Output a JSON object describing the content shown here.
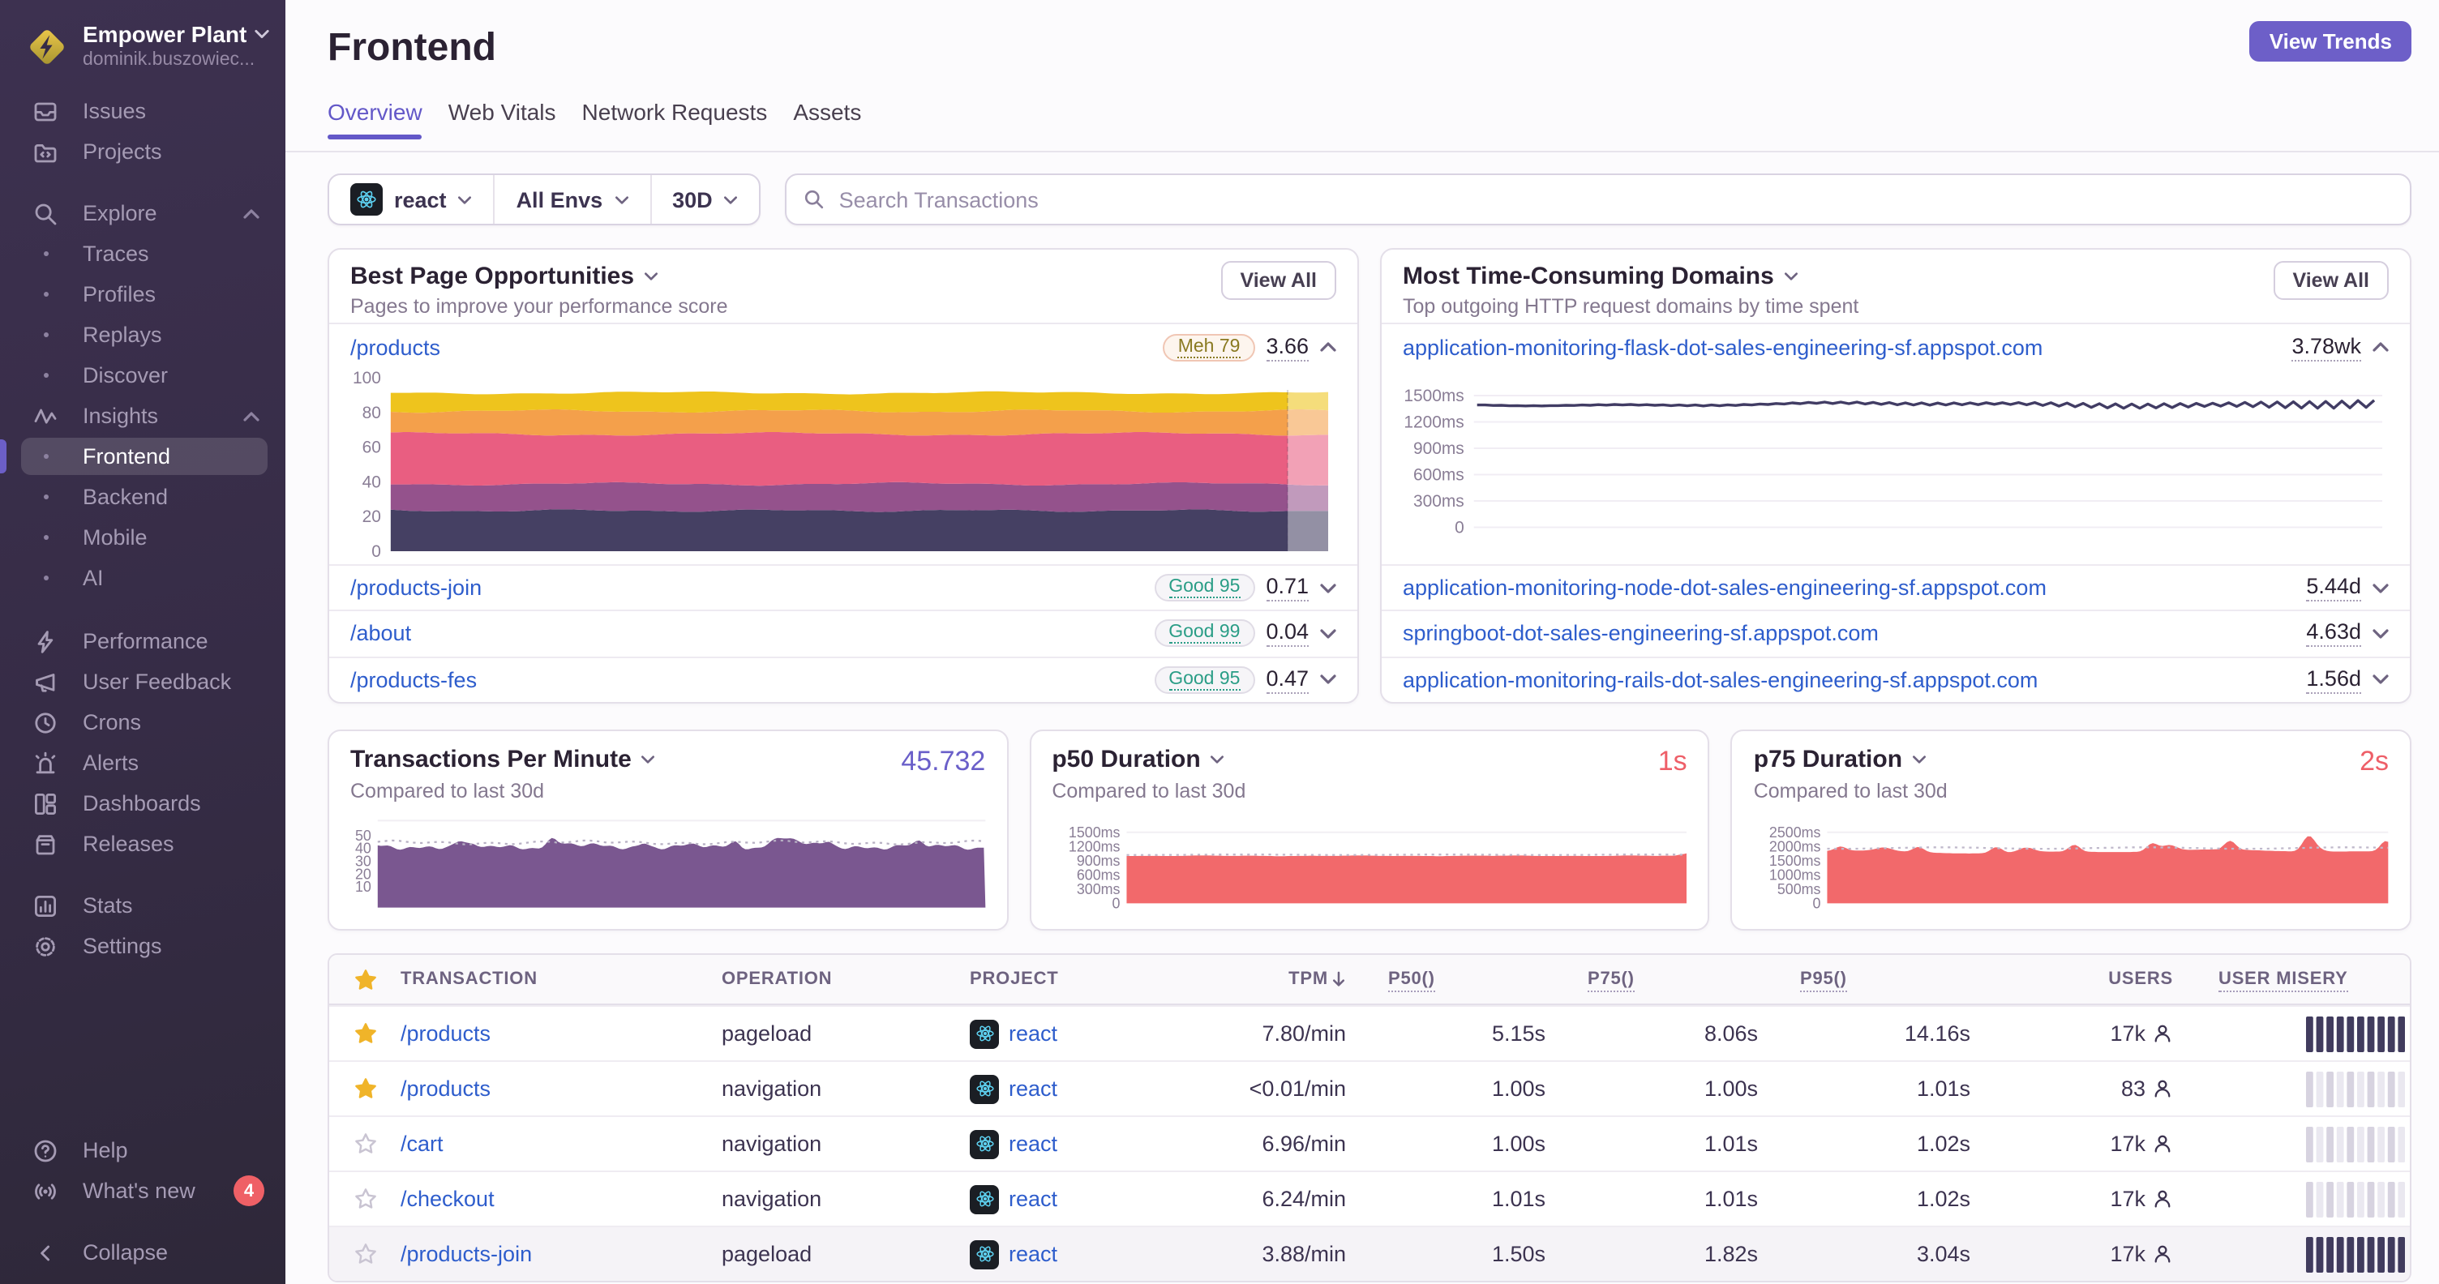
{
  "org": {
    "name": "Empower Plant",
    "email": "dominik.buszowiec..."
  },
  "sidebar": {
    "items": [
      {
        "id": "issues",
        "label": "Issues",
        "icon": "issues"
      },
      {
        "id": "projects",
        "label": "Projects",
        "icon": "projects"
      },
      {
        "id": "explore",
        "label": "Explore",
        "icon": "search",
        "chevron": "up",
        "gap": 13
      },
      {
        "id": "traces",
        "label": "Traces",
        "sub": true
      },
      {
        "id": "profiles",
        "label": "Profiles",
        "sub": true
      },
      {
        "id": "replays",
        "label": "Replays",
        "sub": true
      },
      {
        "id": "discover",
        "label": "Discover",
        "sub": true
      },
      {
        "id": "insights",
        "label": "Insights",
        "icon": "insights",
        "chevron": "up"
      },
      {
        "id": "frontend",
        "label": "Frontend",
        "sub": true,
        "active": true
      },
      {
        "id": "backend",
        "label": "Backend",
        "sub": true
      },
      {
        "id": "mobile",
        "label": "Mobile",
        "sub": true
      },
      {
        "id": "ai",
        "label": "AI",
        "sub": true
      },
      {
        "id": "performance",
        "label": "Performance",
        "icon": "performance",
        "gap": 14
      },
      {
        "id": "user-feedback",
        "label": "User Feedback",
        "icon": "feedback"
      },
      {
        "id": "crons",
        "label": "Crons",
        "icon": "crons"
      },
      {
        "id": "alerts",
        "label": "Alerts",
        "icon": "alerts"
      },
      {
        "id": "dashboards",
        "label": "Dashboards",
        "icon": "dashboards"
      },
      {
        "id": "releases",
        "label": "Releases",
        "icon": "releases"
      },
      {
        "id": "stats",
        "label": "Stats",
        "icon": "stats",
        "gap": 13
      },
      {
        "id": "settings",
        "label": "Settings",
        "icon": "settings"
      }
    ],
    "bottom": [
      {
        "id": "help",
        "label": "Help",
        "icon": "help"
      },
      {
        "id": "whats-new",
        "label": "What's new",
        "icon": "broadcast",
        "badge": "4"
      },
      {
        "id": "collapse",
        "label": "Collapse",
        "icon": "collapse",
        "gap": 13
      }
    ]
  },
  "header": {
    "title": "Frontend",
    "action": "View Trends"
  },
  "tabs": [
    {
      "label": "Overview",
      "active": true
    },
    {
      "label": "Web Vitals"
    },
    {
      "label": "Network Requests"
    },
    {
      "label": "Assets"
    }
  ],
  "filters": {
    "project": "react",
    "env": "All Envs",
    "period": "30D",
    "search_placeholder": "Search Transactions"
  },
  "panels": {
    "opportunities": {
      "title": "Best Page Opportunities",
      "subtitle": "Pages to improve your performance score",
      "action": "View All",
      "rows": [
        {
          "link": "/products",
          "badge": "Meh 79",
          "tone": "meh",
          "value": "3.66",
          "expanded": true
        },
        {
          "link": "/products-join",
          "badge": "Good 95",
          "tone": "good",
          "value": "0.71"
        },
        {
          "link": "/about",
          "badge": "Good 99",
          "tone": "good",
          "value": "0.04"
        },
        {
          "link": "/products-fes",
          "badge": "Good 95",
          "tone": "good",
          "value": "0.47"
        }
      ],
      "chart": {
        "type": "area-stacked",
        "yticks": [
          0,
          20,
          40,
          60,
          80,
          100
        ],
        "bands": [
          23.4,
          38.8,
          67.6,
          80.8,
          91.3
        ],
        "colors": [
          "#454063",
          "#94528c",
          "#e95e81",
          "#f4a04b",
          "#eec41d"
        ]
      }
    },
    "domains": {
      "title": "Most Time-Consuming Domains",
      "subtitle": "Top outgoing HTTP request domains by time spent",
      "action": "View All",
      "rows": [
        {
          "link": "application-monitoring-flask-dot-sales-engineering-sf.appspot.com",
          "value": "3.78wk",
          "expanded": true
        },
        {
          "link": "application-monitoring-node-dot-sales-engineering-sf.appspot.com",
          "value": "5.44d"
        },
        {
          "link": "springboot-dot-sales-engineering-sf.appspot.com",
          "value": "4.63d"
        },
        {
          "link": "application-monitoring-rails-dot-sales-engineering-sf.appspot.com",
          "value": "1.56d"
        }
      ],
      "chart": {
        "type": "line",
        "yticks": [
          "1500ms",
          "1200ms",
          "900ms",
          "600ms",
          "300ms",
          "0"
        ],
        "baseline_ms": 1400,
        "color": "#413c64"
      }
    }
  },
  "cards": [
    {
      "title": "Transactions Per Minute",
      "subtitle": "Compared to last 30d",
      "value": "45.732",
      "accent": "#6a5fc9",
      "chart": {
        "type": "area",
        "color": "#7a5790",
        "yticks": [
          "50",
          "40",
          "30",
          "20",
          "10"
        ],
        "avg": 41.5,
        "compare": 44.6,
        "ymax": 50
      }
    },
    {
      "title": "p50 Duration",
      "subtitle": "Compared to last 30d",
      "value": "1s",
      "accent": "#ee5f68",
      "chart": {
        "type": "area",
        "color": "#f2696b",
        "yticks": [
          "1500ms",
          "1200ms",
          "900ms",
          "600ms",
          "300ms",
          "0"
        ],
        "avg": 1000,
        "compare": 1026,
        "ymax": 1500
      }
    },
    {
      "title": "p75 Duration",
      "subtitle": "Compared to last 30d",
      "value": "2s",
      "accent": "#ee5f68",
      "chart": {
        "type": "area-spiky",
        "color": "#f2696b",
        "yticks": [
          "2500ms",
          "2000ms",
          "1500ms",
          "1000ms",
          "500ms",
          "0"
        ],
        "avg": 1825,
        "compare": 1945,
        "ymax": 2500
      }
    }
  ],
  "table": {
    "headers": [
      "TRANSACTION",
      "OPERATION",
      "PROJECT",
      "TPM",
      "P50()",
      "P75()",
      "P95()",
      "USERS",
      "USER MISERY"
    ],
    "rows": [
      {
        "starred": true,
        "transaction": "/products",
        "operation": "pageload",
        "project": "react",
        "tpm": "7.80/min",
        "p50": "5.15s",
        "p75": "8.06s",
        "p95": "14.16s",
        "users": "17k",
        "misery": "high"
      },
      {
        "starred": true,
        "transaction": "/products",
        "operation": "navigation",
        "project": "react",
        "tpm": "<0.01/min",
        "p50": "1.00s",
        "p75": "1.00s",
        "p95": "1.01s",
        "users": "83",
        "misery": "low"
      },
      {
        "starred": false,
        "transaction": "/cart",
        "operation": "navigation",
        "project": "react",
        "tpm": "6.96/min",
        "p50": "1.00s",
        "p75": "1.01s",
        "p95": "1.02s",
        "users": "17k",
        "misery": "low"
      },
      {
        "starred": false,
        "transaction": "/checkout",
        "operation": "navigation",
        "project": "react",
        "tpm": "6.24/min",
        "p50": "1.01s",
        "p75": "1.01s",
        "p95": "1.02s",
        "users": "17k",
        "misery": "low"
      },
      {
        "starred": false,
        "transaction": "/products-join",
        "operation": "pageload",
        "project": "react",
        "tpm": "3.88/min",
        "p50": "1.50s",
        "p75": "1.82s",
        "p95": "3.04s",
        "users": "17k",
        "misery": "high",
        "highlight": true
      }
    ]
  }
}
